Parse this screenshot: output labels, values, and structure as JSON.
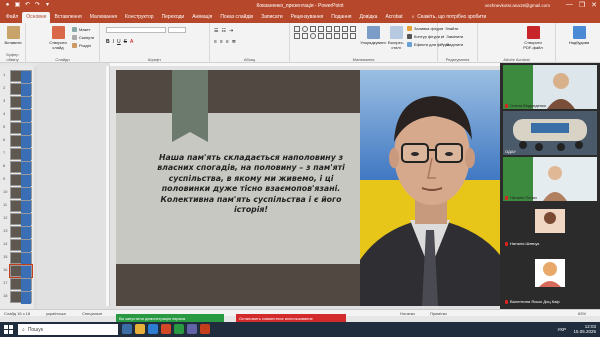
{
  "window": {
    "title": "Ковзаненко_презентація - PowerPoint",
    "user_email": "vezhnevkotsr.ana19@gmail.com",
    "minimize": "—",
    "restore": "❐",
    "close": "✕"
  },
  "tabs": [
    {
      "label": "Файл"
    },
    {
      "label": "Основне",
      "active": true
    },
    {
      "label": "Вставлення"
    },
    {
      "label": "Малювання"
    },
    {
      "label": "Конструктор"
    },
    {
      "label": "Переходи"
    },
    {
      "label": "Анімація"
    },
    {
      "label": "Показ слайдів"
    },
    {
      "label": "Записати"
    },
    {
      "label": "Рецензування"
    },
    {
      "label": "Подання"
    },
    {
      "label": "Довідка"
    },
    {
      "label": "Acrobat"
    }
  ],
  "tellme": "Скажіть, що потрібно зробити",
  "ribbon": {
    "paste": "Вставити",
    "clipboard": "Буфер обміну",
    "new_slide": "Створити слайд",
    "layout": "Макет",
    "reset": "Скинути",
    "section": "Розділ",
    "slides_group": "Слайди",
    "font_group": "Шрифт",
    "paragraph_group": "Абзац",
    "drawing_group": "Малювання",
    "arrange": "Упорядкувати",
    "quick_styles": "Експрес-стилі",
    "shape_fill": "Заливка фігури",
    "shape_outline": "Контур фігури",
    "shape_effects": "Ефекти для фігури",
    "find": "Знайти",
    "replace": "Замінити",
    "select": "Виділити",
    "editing_group": "Редагування",
    "create_pdf": "Створити PDF-файл",
    "acrobat_group": "Adobe Acrobat",
    "designer": "Надбудови",
    "addins_group": "Надбудови"
  },
  "thumbnails": [
    "1",
    "2",
    "3",
    "4",
    "5",
    "6",
    "7",
    "8",
    "9",
    "10",
    "11",
    "12",
    "13",
    "14",
    "15",
    "16",
    "17",
    "18"
  ],
  "selected_thumbnail": "16",
  "slide": {
    "quote": "Наша пам'ять складається наполовину з власних спогадів, на половину – з пам'яті суспільства, в якому ми живемо, і ці половинки дуже тісно взаємопов'язані. Колективна пам'ять суспільства і є його історія!"
  },
  "video": {
    "participants": [
      {
        "name": "Олена Ведмеденко"
      },
      {
        "name": "ОДАУ"
      },
      {
        "name": "Наталія Пелих"
      },
      {
        "name": "Наталія Шевчук"
      },
      {
        "name": "Валентина Ясько Доц Каф"
      }
    ]
  },
  "status": {
    "slide_of": "Слайд 16 з 18",
    "language": "українська",
    "accessibility": "Спеціальні",
    "notes": "Нотатки",
    "comments": "Примітки",
    "zoom": "63%"
  },
  "notifications": {
    "demo": "Ви запустили демонстрацію екрана",
    "stop_share": "Остановить совместное использование"
  },
  "taskbar": {
    "search": "Пошук",
    "lang": "УКР",
    "time": "12:03",
    "date": "15.05.2025"
  }
}
